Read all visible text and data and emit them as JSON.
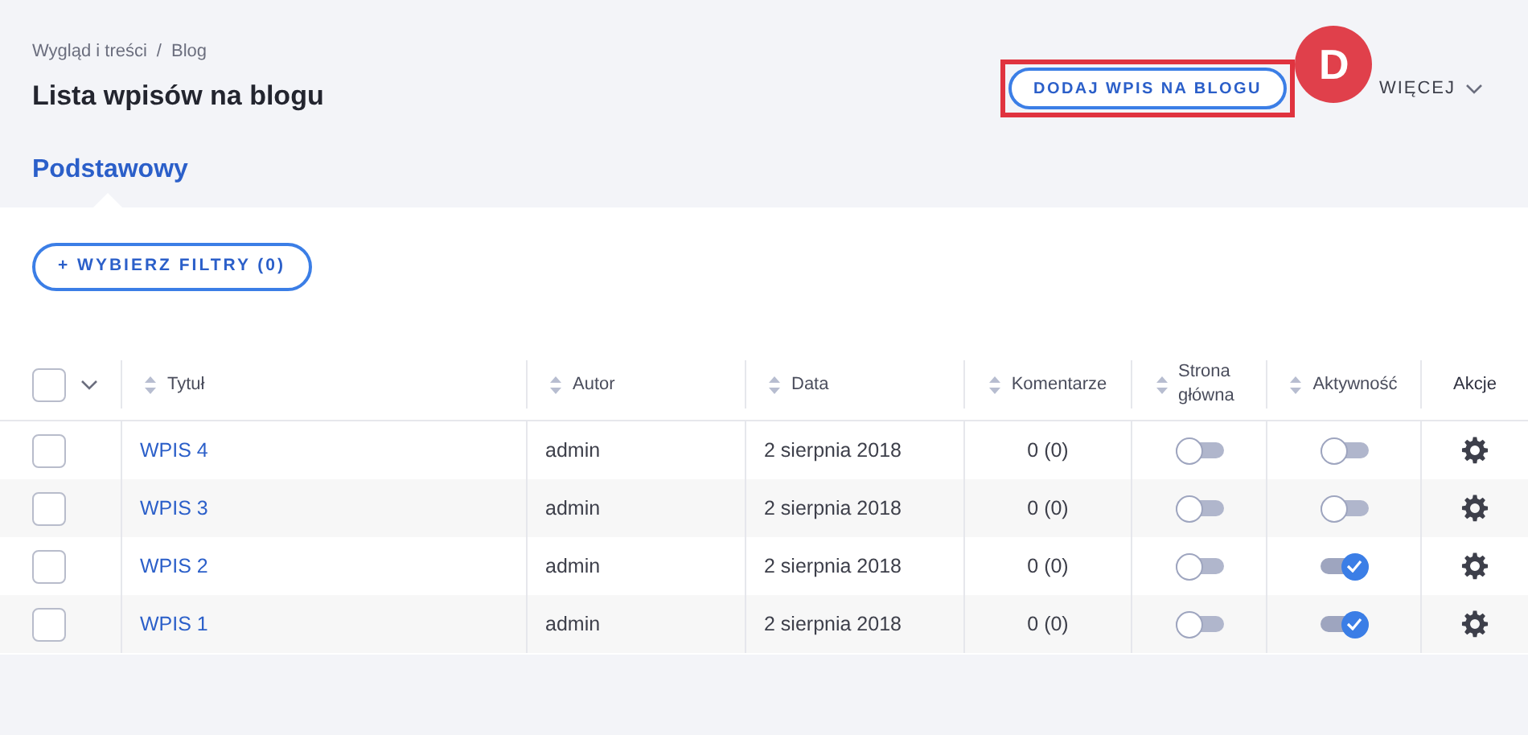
{
  "breadcrumb": [
    "Wygląd i treści",
    "Blog"
  ],
  "breadcrumb_separator": "/",
  "title": "Lista wpisów na blogu",
  "add_button": {
    "label": "DODAJ WPIS NA BLOGU",
    "highlighted": true
  },
  "annotation": {
    "label": "D"
  },
  "more_button": {
    "label": "WIĘCEJ"
  },
  "tabs": [
    {
      "label": "Podstawowy",
      "selected": true
    }
  ],
  "filter_button": {
    "label": "+ WYBIERZ FILTRY (0)"
  },
  "table": {
    "select_all": {
      "checked": false
    },
    "columns": [
      {
        "label": "Tytuł",
        "sortable": true
      },
      {
        "label": "Autor",
        "sortable": true
      },
      {
        "label": "Data",
        "sortable": true
      },
      {
        "label": "Komentarze",
        "sortable": true
      },
      {
        "label": "Strona główna",
        "sortable": true
      },
      {
        "label": "Aktywność",
        "sortable": true
      },
      {
        "label": "Akcje",
        "sortable": false
      }
    ],
    "rows": [
      {
        "checked": false,
        "title": "WPIS 4",
        "author": "admin",
        "date": "2 sierpnia 2018",
        "comments": "0 (0)",
        "homepage": false,
        "active": false
      },
      {
        "checked": false,
        "title": "WPIS 3",
        "author": "admin",
        "date": "2 sierpnia 2018",
        "comments": "0 (0)",
        "homepage": false,
        "active": false
      },
      {
        "checked": false,
        "title": "WPIS 2",
        "author": "admin",
        "date": "2 sierpnia 2018",
        "comments": "0 (0)",
        "homepage": false,
        "active": true
      },
      {
        "checked": false,
        "title": "WPIS 1",
        "author": "admin",
        "date": "2 sierpnia 2018",
        "comments": "0 (0)",
        "homepage": false,
        "active": true
      }
    ]
  }
}
